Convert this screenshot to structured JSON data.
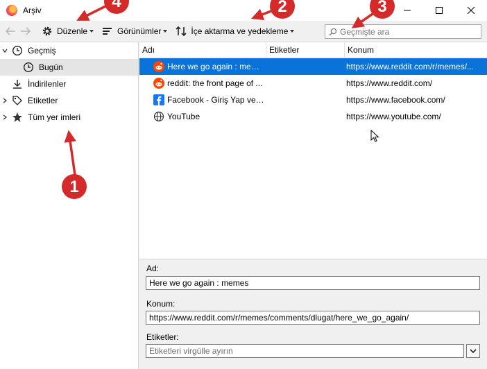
{
  "window": {
    "title": "Arşiv"
  },
  "toolbar": {
    "organize_label": "Düzenle",
    "views_label": "Görünümler",
    "import_label": "İçe aktarma ve yedekleme",
    "search_placeholder": "Geçmişte ara"
  },
  "sidebar": {
    "items": [
      {
        "label": "Geçmiş",
        "icon": "clock-icon",
        "expanded": true
      },
      {
        "label": "Bugün",
        "icon": "clock-icon",
        "selected": true
      },
      {
        "label": "İndirilenler",
        "icon": "download-icon"
      },
      {
        "label": "Etiketler",
        "icon": "tag-icon"
      },
      {
        "label": "Tüm yer imleri",
        "icon": "star-icon"
      }
    ]
  },
  "table": {
    "columns": [
      "Adı",
      "Etiketler",
      "Konum"
    ],
    "rows": [
      {
        "name": "Here we go again : memes",
        "tags": "",
        "location": "https://www.reddit.com/r/memes/...",
        "icon": "reddit-icon",
        "selected": true
      },
      {
        "name": "reddit: the front page of ...",
        "tags": "",
        "location": "https://www.reddit.com/",
        "icon": "reddit-icon"
      },
      {
        "name": "Facebook - Giriş Yap vey...",
        "tags": "",
        "location": "https://www.facebook.com/",
        "icon": "facebook-icon"
      },
      {
        "name": "YouTube",
        "tags": "",
        "location": "https://www.youtube.com/",
        "icon": "globe-icon"
      }
    ]
  },
  "details": {
    "name_label": "Ad:",
    "name_value": "Here we go again : memes",
    "location_label": "Konum:",
    "location_value": "https://www.reddit.com/r/memes/comments/dlugat/here_we_go_again/",
    "tags_label": "Etiketler:",
    "tags_placeholder": "Etiketleri virgülle ayırın"
  },
  "annotations": {
    "badges": [
      "1",
      "2",
      "3",
      "4"
    ],
    "color": "#d42a2a"
  },
  "colors": {
    "selection": "#0a73d9",
    "reddit": "#ff4500",
    "facebook": "#1877f2"
  }
}
